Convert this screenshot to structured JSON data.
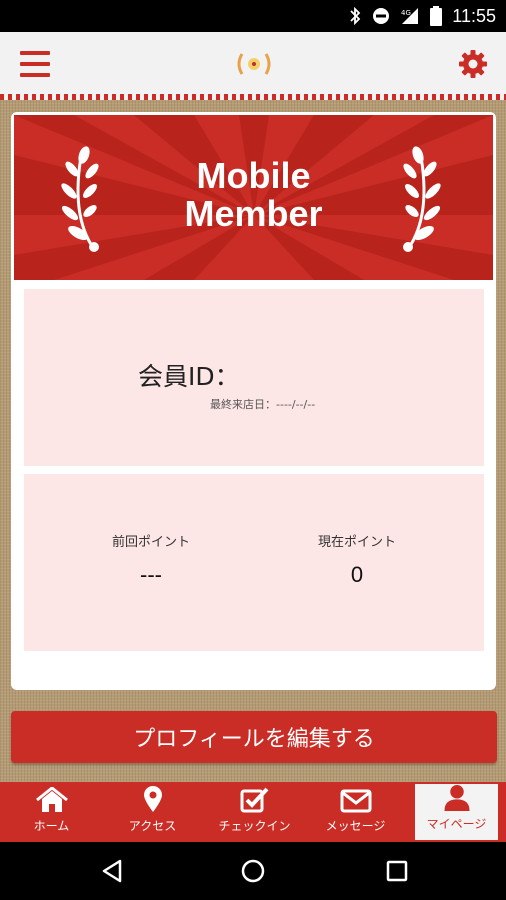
{
  "status_bar": {
    "time": "11:55",
    "network": "4G"
  },
  "header": {
    "menu_icon": "hamburger-menu-icon",
    "logo_icon": "shop-logo-icon",
    "settings_icon": "gear-icon"
  },
  "banner": {
    "line1": "Mobile",
    "line2": "Member"
  },
  "member": {
    "id_label": "会員ID：",
    "last_visit_label": "最終来店日：",
    "last_visit_value": "----/--/--"
  },
  "points": {
    "previous_label": "前回ポイント",
    "previous_value": "---",
    "current_label": "現在ポイント",
    "current_value": "0"
  },
  "edit_profile_label": "プロフィールを編集する",
  "nav": {
    "items": [
      {
        "label": "ホーム",
        "icon": "home-icon"
      },
      {
        "label": "アクセス",
        "icon": "map-pin-icon"
      },
      {
        "label": "チェックイン",
        "icon": "checkbox-icon"
      },
      {
        "label": "メッセージ",
        "icon": "envelope-icon"
      },
      {
        "label": "マイページ",
        "icon": "person-icon"
      }
    ]
  },
  "colors": {
    "primary_red": "#c92d25",
    "panel_pink": "#fde6e6",
    "burlap": "#b49b73"
  }
}
